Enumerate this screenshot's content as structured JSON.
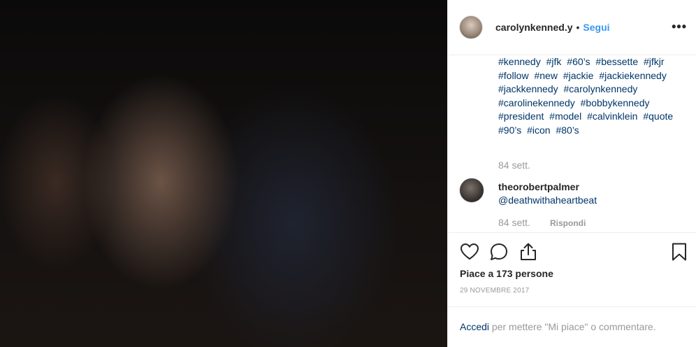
{
  "post": {
    "username": "carolynkenned.y",
    "separator": "•",
    "follow_label": "Segui",
    "more_label": "•••"
  },
  "caption": {
    "hashtags": [
      "#kennedy",
      "#jfk",
      "#60’s",
      "#bessette",
      "#jfkjr",
      "#follow",
      "#new",
      "#jackie",
      "#jackiekennedy",
      "#jackkennedy",
      "#carolynkennedy",
      "#carolinekennedy",
      "#bobbykennedy",
      "#president",
      "#model",
      "#calvinklein",
      "#quote",
      "#90’s",
      "#icon",
      "#80’s"
    ],
    "time": "84 sett."
  },
  "comment": {
    "username": "theorobertpalmer",
    "text": "@deathwithaheartbeat",
    "time": "84 sett.",
    "reply_label": "Rispondi"
  },
  "actions": {
    "icons": [
      "heart-icon",
      "comment-icon",
      "share-icon",
      "bookmark-icon"
    ]
  },
  "likes_text": "Piace a 173 persone",
  "date_text": "29 NOVEMBRE 2017",
  "login": {
    "link_label": "Accedi",
    "rest_text": " per mettere \"Mi piace\" o commentare."
  },
  "colors": {
    "accent": "#3897f0",
    "link": "#003569",
    "muted": "#999999"
  }
}
